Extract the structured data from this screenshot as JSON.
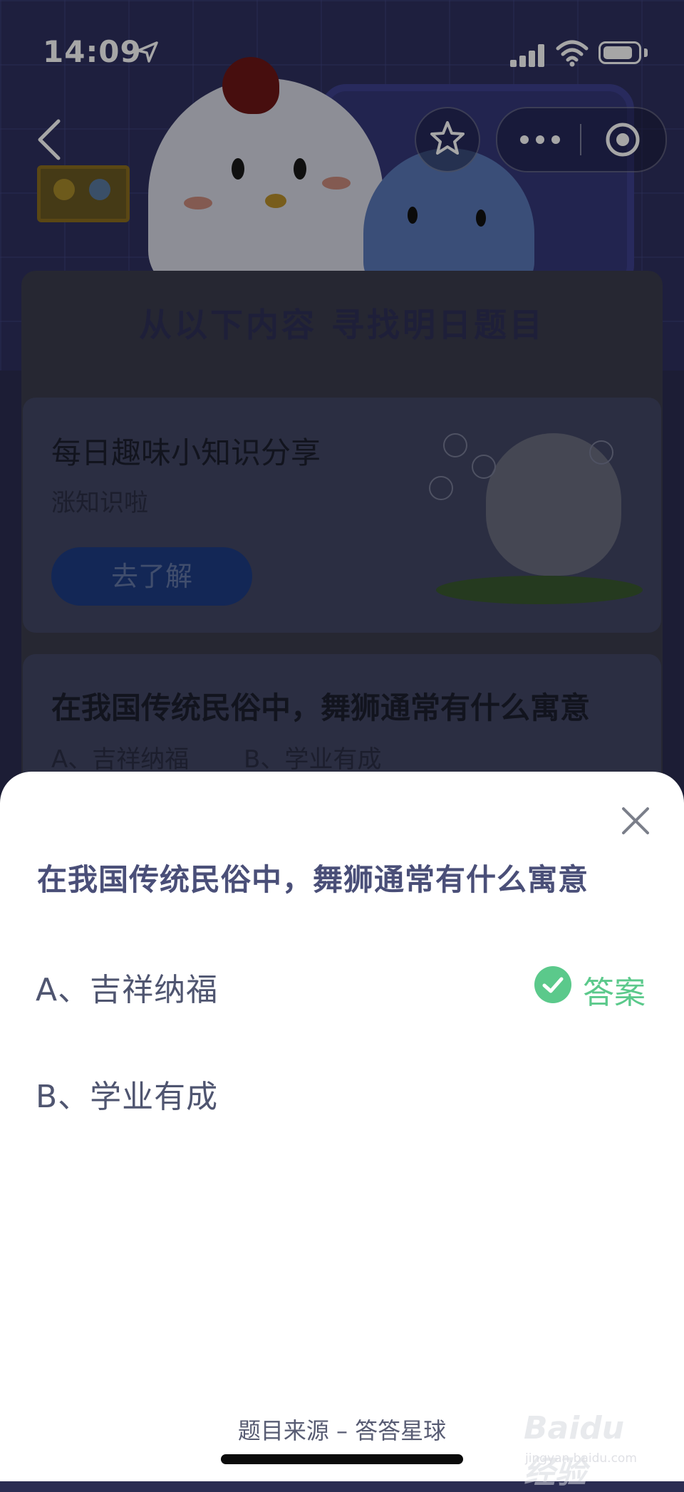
{
  "status_bar": {
    "time": "14:09"
  },
  "background_page": {
    "section_title": "从以下内容 寻找明日题目",
    "card1": {
      "title": "每日趣味小知识分享",
      "subtitle": "涨知识啦",
      "button_label": "去了解"
    },
    "card2": {
      "title": "在我国传统民俗中，舞狮通常有什么寓意",
      "option_a": "A、吉祥纳福",
      "option_b": "B、学业有成"
    }
  },
  "sheet": {
    "question": "在我国传统民俗中，舞狮通常有什么寓意",
    "options": [
      {
        "label": "A、吉祥纳福",
        "is_answer": true
      },
      {
        "label": "B、学业有成",
        "is_answer": false
      }
    ],
    "answer_tag": "答案",
    "source": "题目来源 – 答答星球"
  },
  "watermark": {
    "brand": "Baidu经验",
    "url": "jingyan.baidu.com"
  },
  "colors": {
    "accent_green": "#5bc98b",
    "question_text": "#4a4f78",
    "hero_bg": "#2e3060"
  }
}
